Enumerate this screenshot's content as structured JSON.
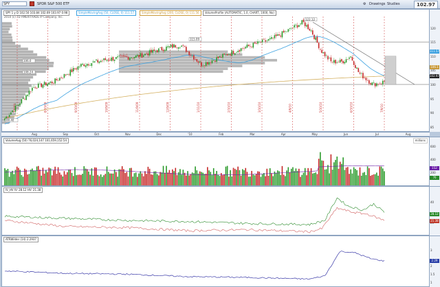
{
  "toolbar": {
    "symbol": "SPY",
    "description": "SPDR S&P 500 ETF",
    "drawings_label": "Drawings",
    "studies_label": "Studies",
    "last_price": "102.97"
  },
  "price_pane": {
    "title": "2010 (c) TD AMERITRADE IP Company, Inc.",
    "ohlc": "SPY 1 y D   102.50   103.84   102.69   103.97   0.98",
    "legends": [
      "SimpleMovingAvg (50, CLOSE, 0)   111.57",
      "SimpleMovingAvg (200, CLOSE, 0)   111.56",
      "VolumeProfile (AUTOMATIC, 1.0, CHART, 1000, No)"
    ],
    "callouts": [
      "115.09",
      "122.12",
      "106.0",
      "108.24",
      "88.40"
    ],
    "axis_labels": [
      "120",
      "115",
      "110",
      "105",
      "100",
      "95",
      "90",
      "85"
    ],
    "axis_tags": [
      {
        "text": "111.57",
        "color": "#3aa0e0"
      },
      {
        "text": "106.1",
        "color": "#c99a3a"
      },
      {
        "text": "102.97",
        "color": "#222222"
      }
    ],
    "event_labels": [
      "7/9/09",
      "8/10/09",
      "9/10/09",
      "10/9/09",
      "11/9/09",
      "12/9/09",
      "1/11/10",
      "2/10/10",
      "3/10/10",
      "4/9/10",
      "5/10/10",
      "6/10/10",
      "7/9/10"
    ]
  },
  "time_axis": {
    "months": [
      "Aug",
      "Sep",
      "Oct",
      "Nov",
      "Dec",
      "'10",
      "Feb",
      "Mar",
      "Apr",
      "May",
      "Jun",
      "Jul",
      "Aug"
    ]
  },
  "volume_pane": {
    "legend": "VolumeAvg (50)   76,024,147   101,659,152.54",
    "units": "millions",
    "axis_labels": [
      "600",
      "400",
      "200"
    ],
    "axis_tags": [
      {
        "text": "152",
        "color": "#6b1fa8"
      },
      {
        "text": "76",
        "color": "#2a8a2a"
      }
    ]
  },
  "vix_pane": {
    "legend": "IV_HV   IV: 28.12   HV: 21.38",
    "axis_labels": [
      "40",
      "20"
    ],
    "axis_tags": [
      {
        "text": "28.12",
        "color": "#2a8a2a"
      },
      {
        "text": "21.38",
        "color": "#c0392b"
      }
    ]
  },
  "atr_pane": {
    "legend": "ATRWilder (14)   2.2937",
    "axis_labels": [
      "3",
      "2",
      "1.5",
      "1"
    ],
    "axis_tags": [
      {
        "text": "2.29",
        "color": "#2a3fa8"
      }
    ]
  },
  "colors": {
    "up": "#2a9a2a",
    "down": "#c62828",
    "sma50": "#3aa0e0",
    "sma200": "#d4b060",
    "profile": "#9a9a9a",
    "iv": "#2a8a2a",
    "hv": "#d06060",
    "atr": "#3a3aa8",
    "event": "#cc3333"
  }
}
